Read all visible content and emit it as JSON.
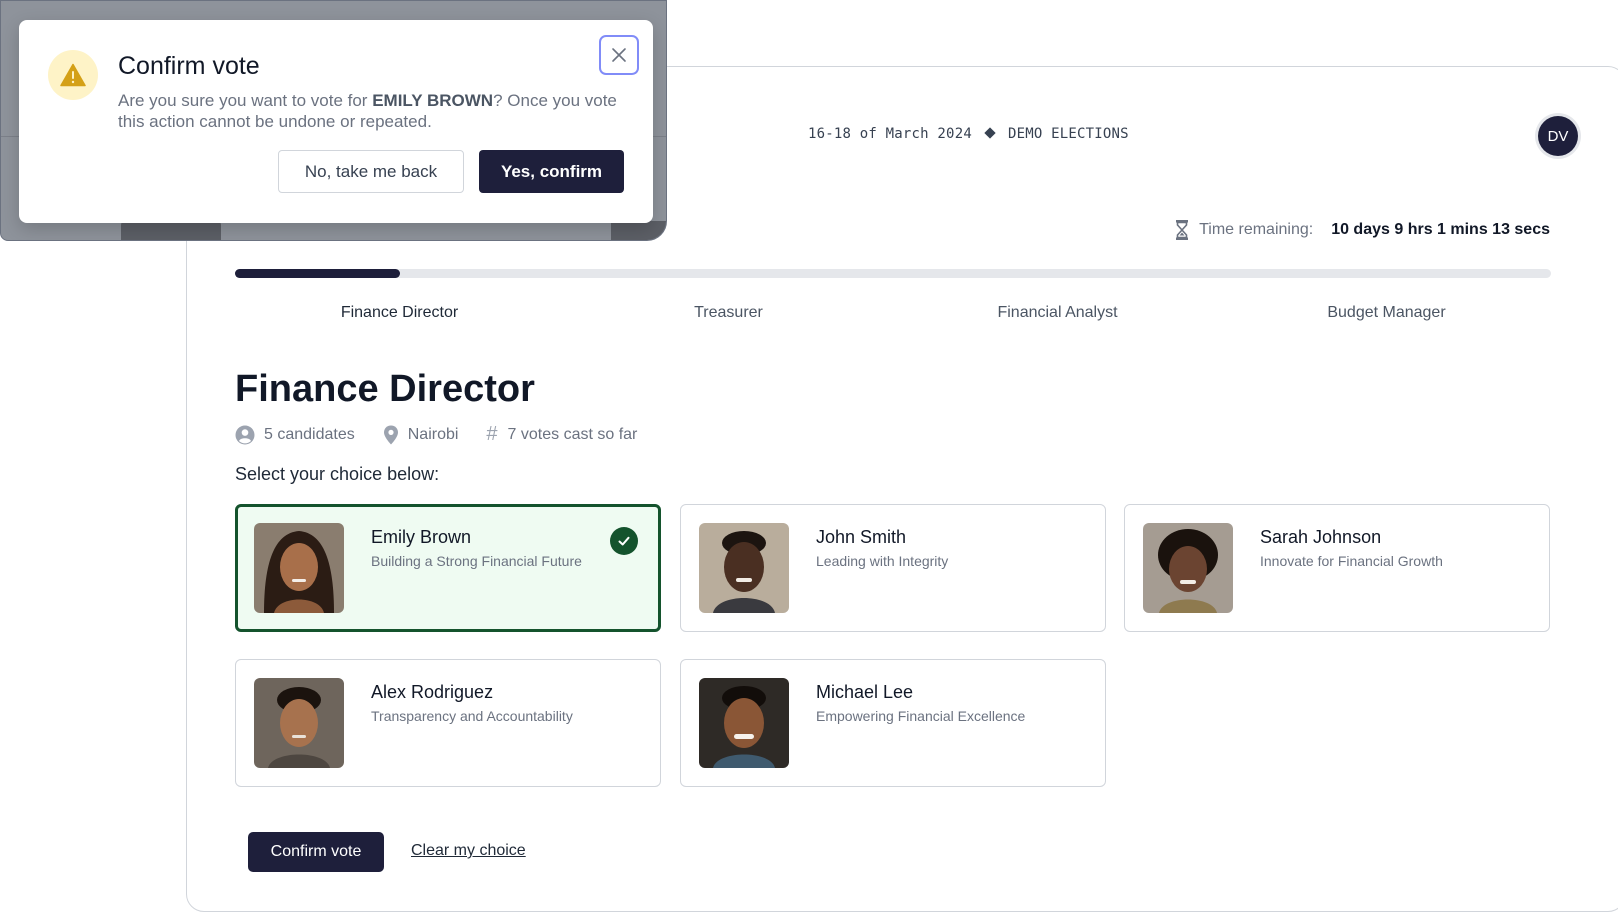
{
  "header": {
    "date": "16-18 of March 2024",
    "election": "DEMO ELECTIONS",
    "avatar_initials": "DV"
  },
  "timer": {
    "label": "Time remaining:",
    "value": "10 days 9 hrs 1 mins 13 secs"
  },
  "progress": {
    "fraction": 0.125
  },
  "tabs": [
    {
      "label": "Finance Director",
      "active": true
    },
    {
      "label": "Treasurer",
      "active": false
    },
    {
      "label": "Financial Analyst",
      "active": false
    },
    {
      "label": "Budget Manager",
      "active": false
    }
  ],
  "position": {
    "title": "Finance Director",
    "candidates_count": "5 candidates",
    "location": "Nairobi",
    "votes_cast": "7 votes cast so far"
  },
  "prompt": "Select your choice below:",
  "candidates": [
    {
      "name": "Emily Brown",
      "slogan": "Building a Strong Financial Future",
      "selected": true
    },
    {
      "name": "John Smith",
      "slogan": "Leading with Integrity",
      "selected": false
    },
    {
      "name": "Sarah Johnson",
      "slogan": "Innovate for Financial Growth",
      "selected": false
    },
    {
      "name": "Alex Rodriguez",
      "slogan": "Transparency and Accountability",
      "selected": false
    },
    {
      "name": "Michael Lee",
      "slogan": "Empowering Financial Excellence",
      "selected": false
    }
  ],
  "actions": {
    "confirm_label": "Confirm vote",
    "clear_label": "Clear my choice"
  },
  "modal": {
    "title": "Confirm vote",
    "message_before": "Are you sure you want to vote for ",
    "candidate_upper": "EMILY BROWN",
    "message_after": "? Once you vote this action cannot be undone or repeated.",
    "back_label": "No, take me back",
    "yes_label": "Yes, confirm"
  },
  "colors": {
    "primary": "#1e1f3b",
    "selected_border": "#14532d",
    "selected_bg": "#effbf2",
    "warning_bg": "#fef3c7",
    "warning_icon": "#d4a017"
  }
}
